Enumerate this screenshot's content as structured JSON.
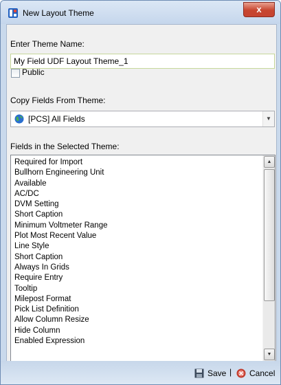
{
  "window": {
    "title": "New Layout Theme",
    "close_label": "x"
  },
  "form": {
    "theme_name_label": "Enter Theme Name:",
    "theme_name_value": "My Field UDF Layout Theme_1",
    "public_label": "Public",
    "public_checked": false,
    "copy_from_label": "Copy Fields From Theme:",
    "copy_from_value": "[PCS] All Fields",
    "fields_label": "Fields in the Selected Theme:"
  },
  "fields": [
    "Required for Import",
    "Bullhorn Engineering Unit",
    "Available",
    "AC/DC",
    "DVM Setting",
    "Short Caption",
    "Minimum Voltmeter Range",
    "Plot Most Recent Value",
    "Line Style",
    "Short Caption",
    "Always In Grids",
    "Require Entry",
    "Tooltip",
    "Milepost Format",
    "Pick List Definition",
    "Allow Column Resize",
    "Hide Column",
    "Enabled Expression"
  ],
  "footer": {
    "save_label": "Save",
    "separator": "|",
    "cancel_label": "Cancel"
  },
  "colors": {
    "title_bar": "#c5d6ec",
    "close_button": "#c7452f",
    "input_border": "#c6d79a"
  }
}
